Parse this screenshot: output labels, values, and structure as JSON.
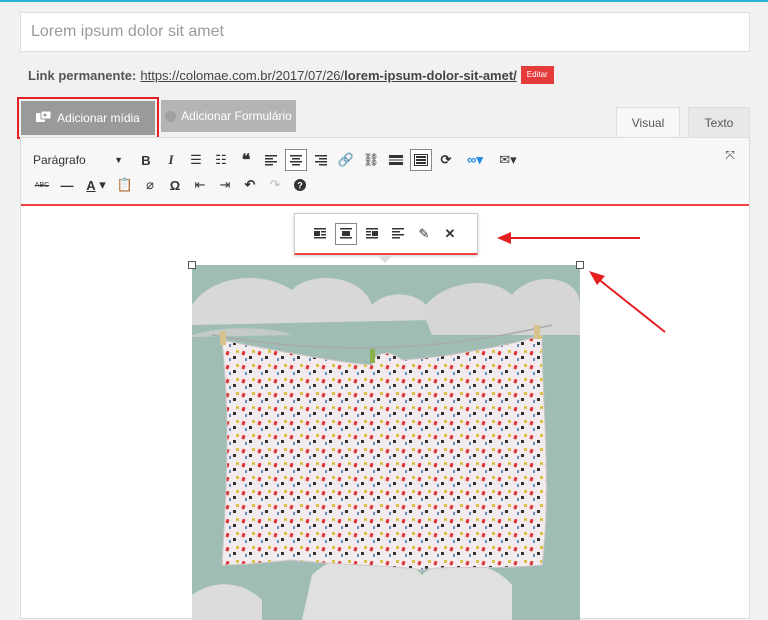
{
  "title": {
    "value": "Lorem ipsum dolor sit amet"
  },
  "permalink": {
    "label": "Link permanente:",
    "url_base": "https://colomae.com.br/2017/07/26/",
    "url_slug": "lorem-ipsum-dolor-sit-amet/",
    "edit_label": "Editar"
  },
  "media_buttons": {
    "add_media": "Adicionar mídia",
    "add_form": "Adicionar Formulário"
  },
  "tabs": {
    "visual": "Visual",
    "text": "Texto"
  },
  "toolbar": {
    "format_select": "Parágrafo"
  },
  "colors": {
    "accent_red": "#e51f1f",
    "toolbar_underline": "#ee4444",
    "photo_background": "#8fb5a8"
  }
}
